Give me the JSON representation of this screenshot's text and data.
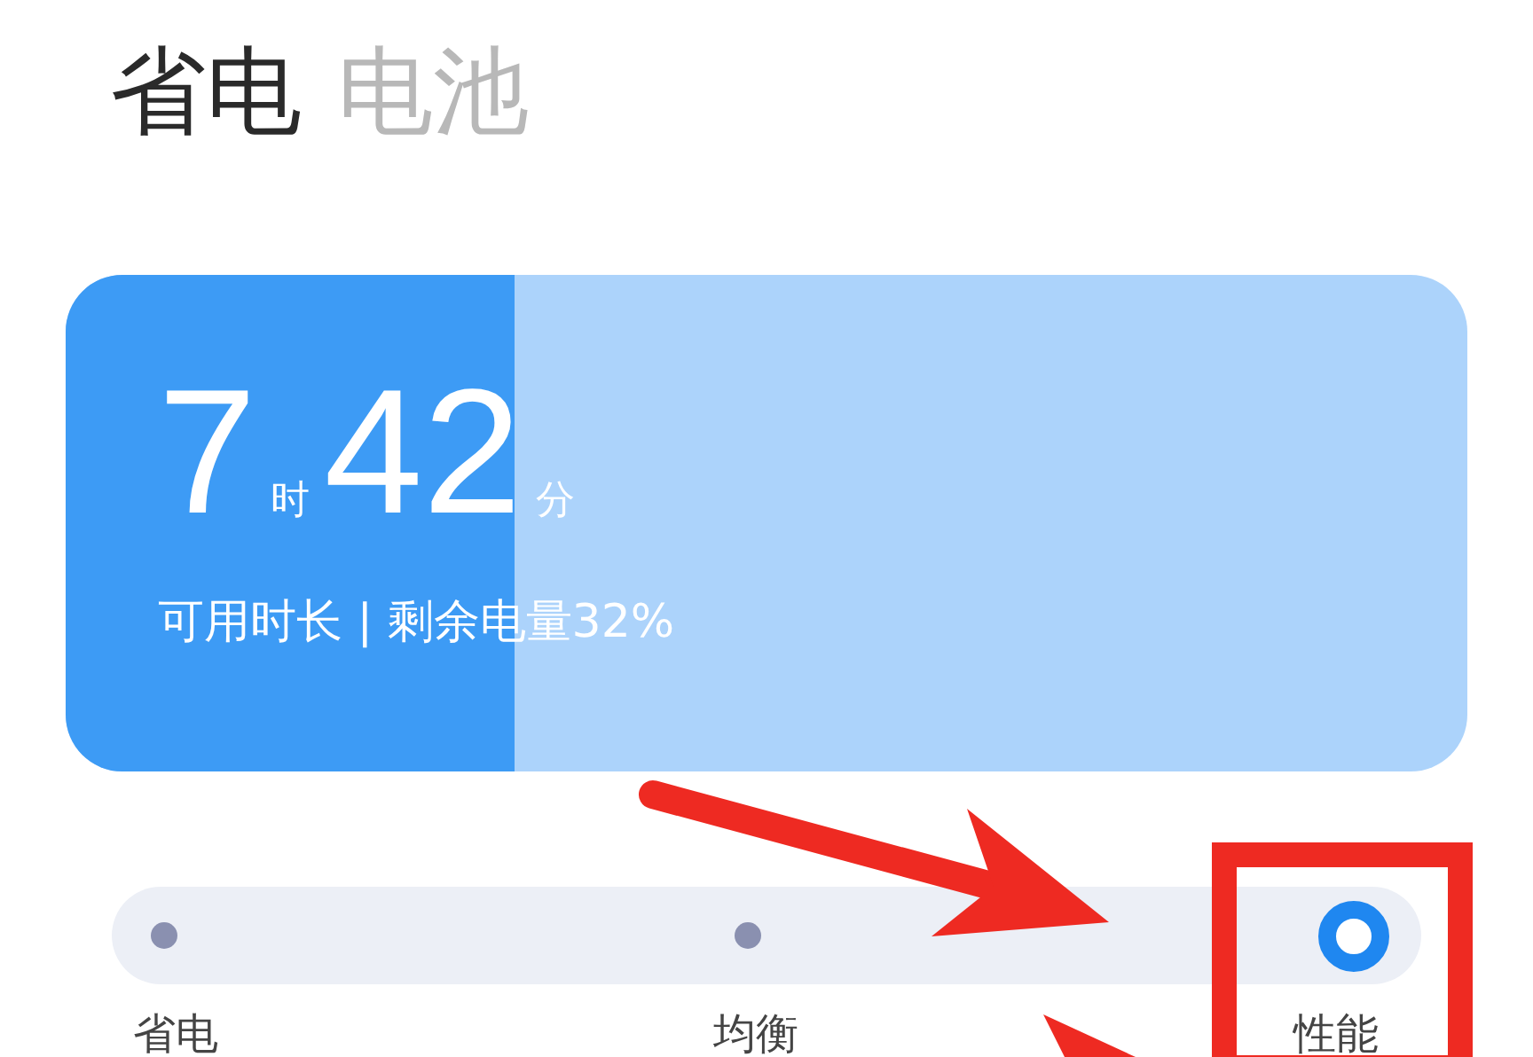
{
  "tabs": [
    {
      "label": "省电",
      "selected": true
    },
    {
      "label": "电池",
      "selected": false
    }
  ],
  "battery_card": {
    "level": 0.32,
    "hours": "7",
    "hours_unit": "时",
    "minutes": "42",
    "minutes_unit": "分",
    "subtitle": "可用时长 | 剩余电量32%"
  },
  "modes": [
    {
      "label": "省电",
      "selected": false
    },
    {
      "label": "均衡",
      "selected": false
    },
    {
      "label": "性能",
      "selected": true
    }
  ]
}
